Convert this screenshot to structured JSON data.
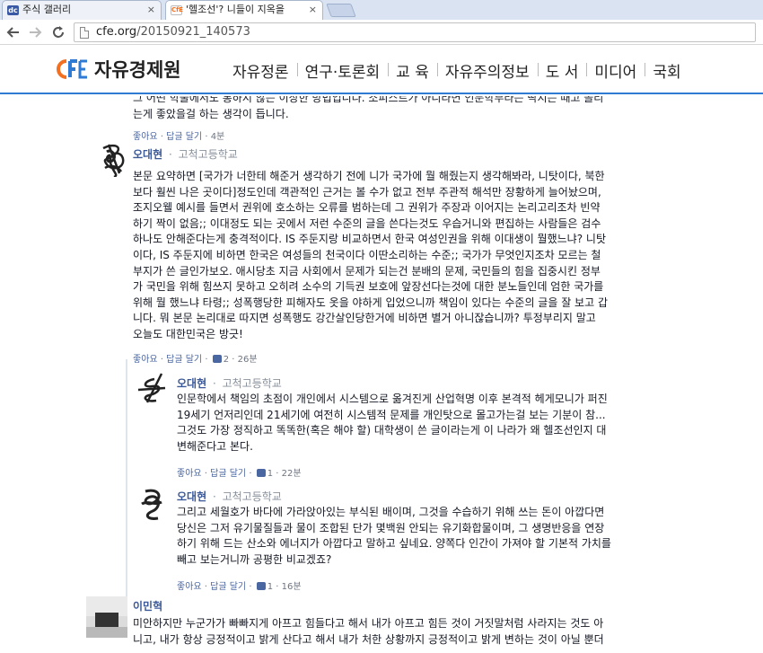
{
  "browser": {
    "tabs": [
      {
        "favicon": "dc",
        "title": "주식 갤러리",
        "close": "×"
      },
      {
        "favicon": "CfE",
        "title": "'헬조선'? 니들이 지옥을",
        "close": "×"
      }
    ],
    "url_host": "cfe.org",
    "url_path": "/20150921_140573",
    "icons": {
      "back": "back-arrow-icon",
      "forward": "forward-arrow-icon",
      "reload": "reload-icon"
    }
  },
  "site": {
    "logo_mark": "CFE",
    "logo_text": "자유경제원",
    "nav": [
      "자유정론",
      "연구·토론회",
      "교 육",
      "자유주의정보",
      "도 서",
      "미디어",
      "국회"
    ],
    "accent": "#2f7bd4",
    "logo_orange": "#f37021"
  },
  "comments": {
    "top": {
      "lines": [
        "그 어떤 학술에서도 통하지 않는 이상한 방법입니다. 소피스트가 아니라면 인문학부라는 딱지는 때고 올리",
        "는게 좋았을걸 하는 생각이 듭니다."
      ],
      "like": "좋아요",
      "reply": "답글 달기",
      "time": "4분"
    },
    "c1": {
      "name": "오대현",
      "affiliation": "고척고등학교",
      "lines": [
        "본문 요약하면 [국가가 너한테 해준거 생각하기 전에 니가 국가에 뭘 해줬는지 생각해봐라, 니탓이다, 북한",
        "보다 훨씬 나은 곳이다]정도인데 객관적인 근거는 볼 수가 없고 전부 주관적 해석만 장황하게 늘어놨으며,",
        "조지오웰 예시를 들면서 권위에 호소하는 오류를 범하는데 그 권위가 주장과 이어지는 논리고리조차 빈약",
        "하기 짝이 없음;; 이대정도 되는 곳에서 저런 수준의 글을 쓴다는것도 우습거니와 편집하는 사람들은 검수",
        "하나도 안해준다는게 충격적이다. IS 주둔지랑 비교하면서 한국 여성인권을 위해 이대생이 뭘했느냐? 니탓",
        "이다, IS 주둔지에 비하면 한국은 여성들의 천국이다 이딴소리하는 수준;; 국가가 무엇인지조차 모르는 철",
        "부지가 쓴 글인가보오. 애시당초 지금 사회에서 문제가 되는건 분배의 문제, 국민들의 힘을 집중시킨 정부",
        "가 국민을 위해 힘쓰지 못하고 오히려 소수의 기득권 보호에 앞장선다는것에 대한 분노들인데 엄한 국가를",
        "위해 뭘 했느냐 타령;; 성폭행당한 피해자도 옷을 야하게 입었으니까 책임이 있다는 수준의 글을 잘 보고 갑",
        "니다. 뭐 본문 논리대로 따지면 성폭행도 강간살인당한거에 비하면 별거 아니잖습니까? 투정부리지 말고",
        "오늘도 대한민국은 방긋!"
      ],
      "like": "좋아요",
      "reply": "답글 달기",
      "likes": "2",
      "time": "26분"
    },
    "r1": {
      "name": "오대현",
      "affiliation": "고척고등학교",
      "lines": [
        "인문학에서 책임의 초점이 개인에서 시스템으로 옮겨진게 산업혁명 이후 본격적 헤게모니가 퍼진",
        "19세기 언저리인데 21세기에 여전히 시스템적 문제를 개인탓으로 몰고가는걸 보는 기분이 참...",
        "그것도 가장 정직하고 똑똑한(혹은 해야 할) 대학생이 쓴 글이라는게 이 나라가 왜 헬조선인지 대",
        "변해준다고 본다."
      ],
      "like": "좋아요",
      "reply": "답글 달기",
      "likes": "1",
      "time": "22분"
    },
    "r2": {
      "name": "오대현",
      "affiliation": "고척고등학교",
      "lines": [
        "그리고 세월호가 바다에 가라앉아있는 부식된 배이며, 그것을 수습하기 위해 쓰는 돈이 아깝다면",
        "당신은 그저 유기물질들과 물이 조합된 단가 몇백원 안되는 유기화합물이며, 그 생명반응을 연장",
        "하기 위해 드는 산소와 에너지가 아깝다고 말하고 싶네요. 양쪽다 인간이 가져야 할 기본적 가치를",
        "빼고 보는거니까 공평한 비교겠죠?"
      ],
      "like": "좋아요",
      "reply": "답글 달기",
      "likes": "1",
      "time": "16분"
    },
    "c2": {
      "name": "이민혁",
      "lines": [
        "미안하지만 누군가가 빠빠지게 아프고 힘들다고 해서 내가 아프고 힘든 것이 거짓말처럼 사라지는 것도 아",
        "니고, 내가 항상 긍정적이고 밝게 산다고 해서 내가 처한 상황까지 긍정적이고 밝게 변하는 것이 아닐 뿐더"
      ]
    }
  }
}
